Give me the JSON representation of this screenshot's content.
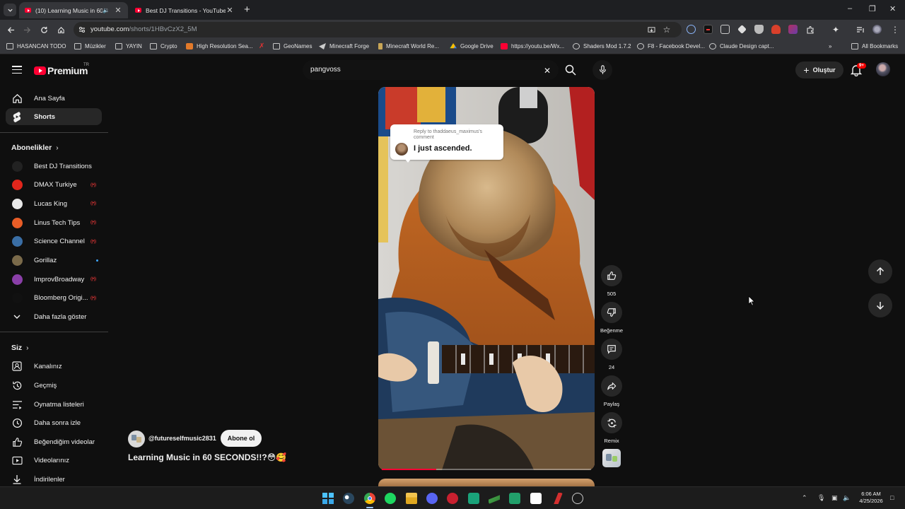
{
  "browser": {
    "tabs": [
      {
        "title": "(10) Learning Music in 60 SE",
        "active": true,
        "audio": true
      },
      {
        "title": "Best DJ Transitions - YouTube",
        "active": false,
        "audio": false
      }
    ],
    "url_host": "youtube.com",
    "url_path": "/shorts/1HBvCzX2_5M",
    "bookmarks": [
      "HASANCAN TODO",
      "Müzikler",
      "YAYIN",
      "Crypto",
      "High Resolution Sea...",
      "GeoNames",
      "Minecraft Forge",
      "Minecraft World Re...",
      "Google Drive",
      "https://youtu.be/Wx...",
      "Shaders Mod 1.7.2",
      "F8 - Facebook Devel...",
      "Claude Design capt..."
    ],
    "all_bookmarks": "All Bookmarks"
  },
  "youtube": {
    "logo_text": "Premium",
    "country": "TR",
    "search_query": "pangvoss",
    "create_label": "Oluştur",
    "notif_count": "9+",
    "sidebar": {
      "top": [
        {
          "label": "Ana Sayfa",
          "icon": "home-icon"
        },
        {
          "label": "Shorts",
          "icon": "shorts-icon"
        }
      ],
      "subs_title": "Abonelikler",
      "subs": [
        {
          "label": "Best DJ Transitions",
          "status": "none",
          "color": "#222222"
        },
        {
          "label": "DMAX Turkiye",
          "status": "live",
          "color": "#e1261c"
        },
        {
          "label": "Lucas King",
          "status": "live",
          "color": "#e8e8e8"
        },
        {
          "label": "Linus Tech Tips",
          "status": "live",
          "color": "#e85d27"
        },
        {
          "label": "Science Channel",
          "status": "live",
          "color": "#3a6ea5"
        },
        {
          "label": "Gorillaz",
          "status": "new",
          "color": "#7a6a4a"
        },
        {
          "label": "ImprovBroadway",
          "status": "live",
          "color": "#8a3fa8"
        },
        {
          "label": "Bloomberg Origi...",
          "status": "live",
          "color": "#111111"
        }
      ],
      "show_more": "Daha fazla göster",
      "you_title": "Siz",
      "you": [
        {
          "label": "Kanalınız",
          "icon": "channel-icon"
        },
        {
          "label": "Geçmiş",
          "icon": "history-icon"
        },
        {
          "label": "Oynatma listeleri",
          "icon": "playlists-icon"
        },
        {
          "label": "Daha sonra izle",
          "icon": "watch-later-icon"
        },
        {
          "label": "Beğendiğim videolar",
          "icon": "liked-icon"
        },
        {
          "label": "Videolarınız",
          "icon": "your-videos-icon"
        },
        {
          "label": "İndirilenler",
          "icon": "downloads-icon"
        }
      ]
    },
    "short": {
      "reply_to": "Reply to thaddaeus_maximus's comment",
      "reply_text": "I just ascended.",
      "channel": "@futureselfmusic2831",
      "subscribe": "Abone ol",
      "title": "Learning Music in 60 SECONDS!!?😳🥰",
      "progress": 0.26,
      "likes": "505",
      "dislike_label": "Beğenme",
      "comments": "24",
      "share_label": "Paylaş",
      "remix_label": "Remix"
    }
  },
  "taskbar": {
    "time": "6:06 AM",
    "date": "4/25/2026"
  }
}
